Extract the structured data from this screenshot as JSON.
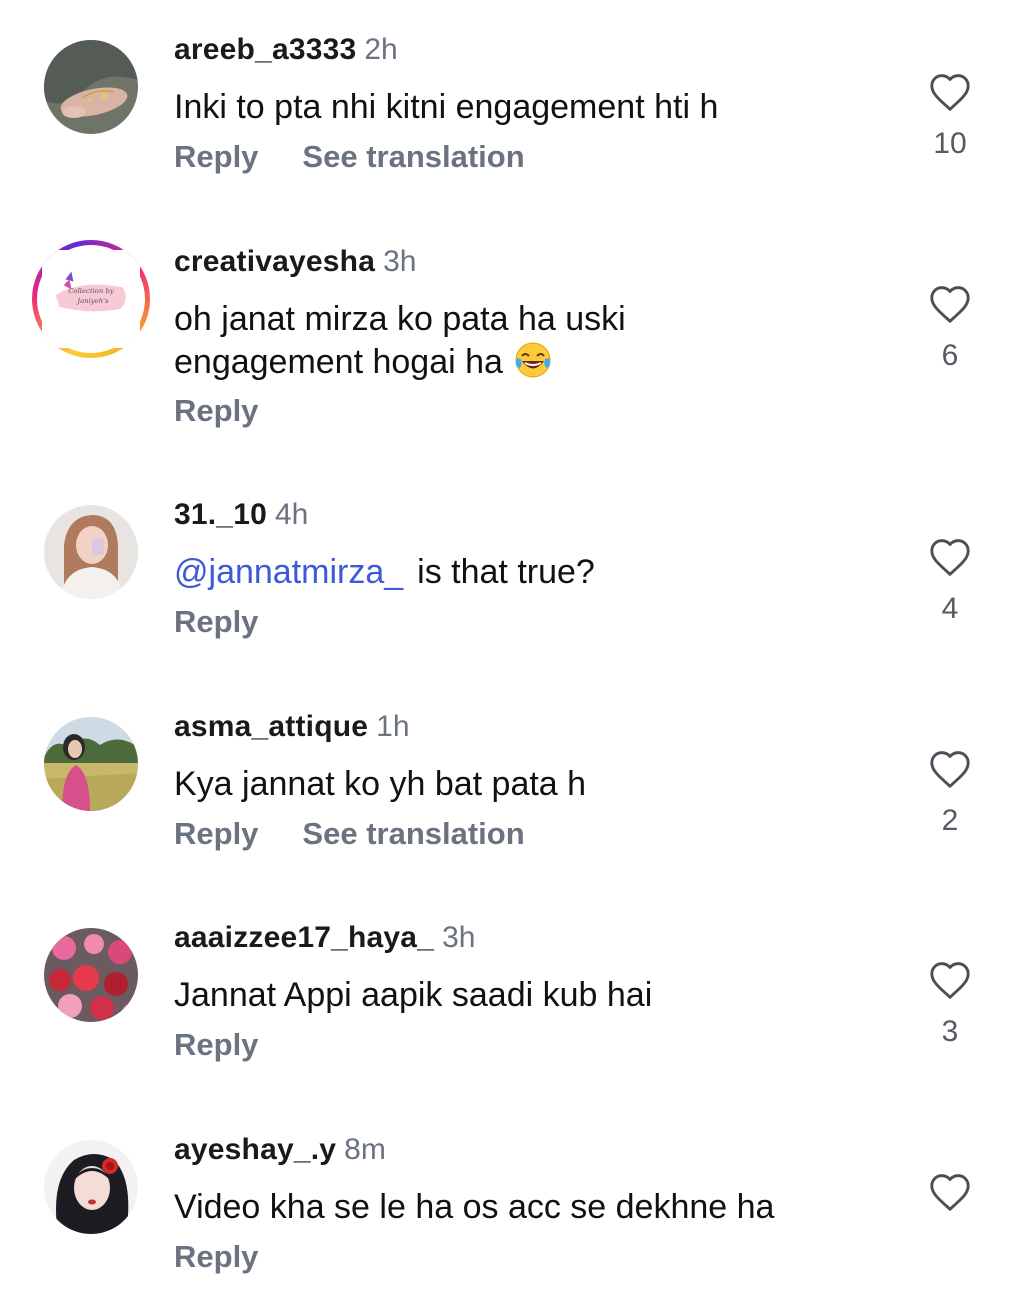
{
  "comments": [
    {
      "username": "areeb_a3333",
      "time": "2h",
      "text": "Inki to pta nhi kitni engagement hti h",
      "reply": "Reply",
      "translate": "See translation",
      "likes": "10"
    },
    {
      "username": "creativayesha",
      "time": "3h",
      "text": "oh janat mirza ko pata ha uski engagement hogai ha",
      "emoji": "😂",
      "reply": "Reply",
      "likes": "6"
    },
    {
      "username": "31._10",
      "time": "4h",
      "mention": "@jannatmirza_",
      "text": "is that true?",
      "reply": "Reply",
      "likes": "4"
    },
    {
      "username": "asma_attique",
      "time": "1h",
      "text": "Kya jannat ko yh bat pata h",
      "reply": "Reply",
      "translate": "See translation",
      "likes": "2"
    },
    {
      "username": "aaaizzee17_haya_",
      "time": "3h",
      "text": "Jannat Appi aapik saadi kub hai",
      "reply": "Reply",
      "likes": "3"
    },
    {
      "username": "ayeshay_.y",
      "time": "8m",
      "text": "Video kha se le ha os acc se dekhne ha",
      "reply": "Reply",
      "likes": ""
    }
  ],
  "colors": {
    "mention": "#3b5bd6",
    "secondary_text": "#6b7280",
    "story_ring_start": "#f9ce34",
    "story_ring_end": "#ee2a7b"
  },
  "icons": {
    "like": "heart-outline-icon",
    "emoji": "face-with-tears-of-joy"
  }
}
